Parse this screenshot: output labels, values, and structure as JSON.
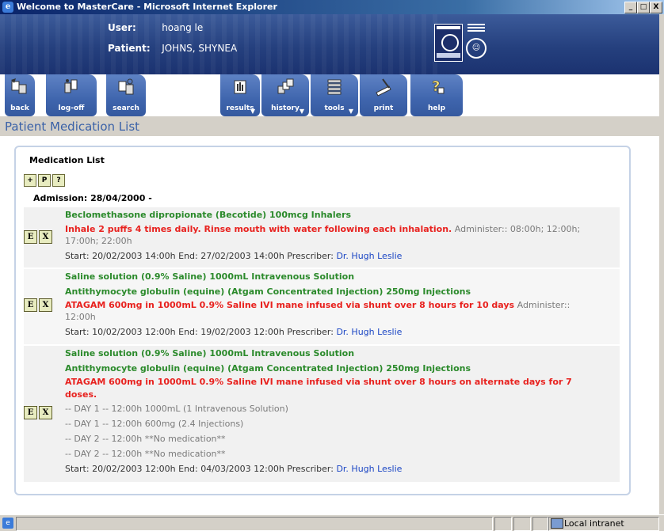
{
  "window": {
    "title": "Welcome to MasterCare - Microsoft Internet Explorer",
    "controls": [
      "_",
      "□",
      "X"
    ]
  },
  "header": {
    "user_label": "User:",
    "user_value": "hoang le",
    "patient_label": "Patient:",
    "patient_value": "JOHNS, SHYNEA"
  },
  "toolbar": {
    "tabs": [
      {
        "label": "back",
        "icon": "back-icon"
      },
      {
        "label": "log-off",
        "icon": "log-off-icon"
      },
      {
        "label": "search",
        "icon": "search-icon"
      },
      {
        "label": "results",
        "icon": "results-icon"
      },
      {
        "label": "history",
        "icon": "history-icon"
      },
      {
        "label": "tools",
        "icon": "tools-icon"
      },
      {
        "label": "print",
        "icon": "print-icon"
      },
      {
        "label": "help",
        "icon": "help-icon"
      }
    ]
  },
  "page_title": "Patient Medication List",
  "panel": {
    "title": "Medication List",
    "small_buttons": [
      "+",
      "P",
      "?"
    ],
    "admission": "Admission: 28/04/2000 -",
    "row_buttons": [
      "E",
      "X"
    ],
    "medications": [
      {
        "drugs": [
          "Beclomethasone dipropionate (Becotide) 100mcg Inhalers"
        ],
        "instruction": "Inhale 2 puffs 4 times daily. Rinse mouth with water following each inhalation.",
        "administer_1": "Administer:: 08:00h; 12:00h;",
        "administer_2": "17:00h; 22:00h",
        "start": "Start: 20/02/2003 14:00h End: 27/02/2003 14:00h Prescriber:",
        "prescriber": "Dr. Hugh Leslie"
      },
      {
        "drugs": [
          "Saline solution (0.9% Saline) 1000mL Intravenous Solution",
          "Antithymocyte globulin (equine) (Atgam Concentrated Injection) 250mg Injections"
        ],
        "instruction": "ATAGAM 600mg in 1000mL 0.9% Saline IVI mane infused via shunt over 8 hours for 10 days",
        "administer_1": "Administer::",
        "administer_2": "12:00h",
        "start": "Start: 10/02/2003 12:00h End: 19/02/2003 12:00h Prescriber:",
        "prescriber": "Dr. Hugh Leslie"
      },
      {
        "drugs": [
          "Saline solution (0.9% Saline) 1000mL Intravenous Solution",
          "Antithymocyte globulin (equine) (Atgam Concentrated Injection) 250mg Injections"
        ],
        "instruction_1": "ATAGAM 600mg in 1000mL 0.9% Saline IVI mane infused via shunt over 8 hours on alternate days for 7",
        "instruction_2": "doses.",
        "doses": [
          "-- DAY 1 -- 12:00h 1000mL (1 Intravenous Solution)",
          "-- DAY 1 -- 12:00h 600mg (2.4 Injections)",
          "-- DAY 2 -- 12:00h **No medication**",
          "-- DAY 2 -- 12:00h **No medication**"
        ],
        "start": "Start: 20/02/2003 12:00h End: 04/03/2003 12:00h Prescriber:",
        "prescriber": "Dr. Hugh Leslie"
      }
    ]
  },
  "statusbar": {
    "zone": "Local intranet"
  }
}
